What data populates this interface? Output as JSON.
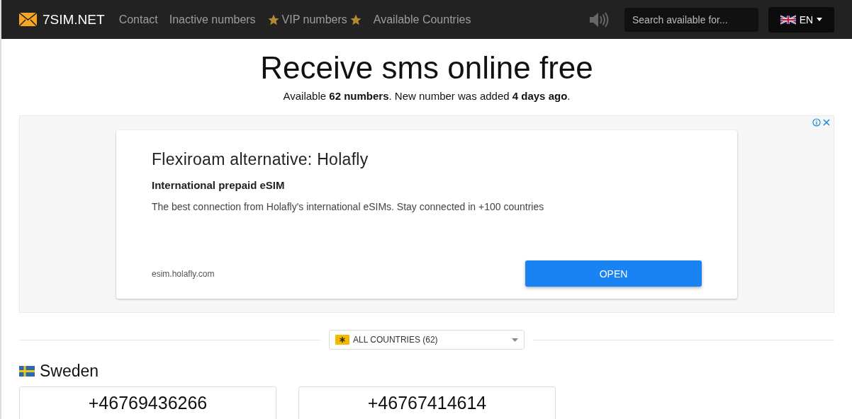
{
  "navbar": {
    "logo": "7SIM.NET",
    "links": [
      {
        "label": "Contact",
        "kind": "plain"
      },
      {
        "label": "Inactive numbers",
        "kind": "plain"
      },
      {
        "label": "VIP numbers",
        "kind": "starred"
      },
      {
        "label": "Available Countries",
        "kind": "plain"
      }
    ],
    "search": {
      "placeholder": "Search available for..."
    },
    "language": "EN"
  },
  "header": {
    "title": "Receive sms online free",
    "subtitle": "Available **62 numbers**. New number was added **4 days ago**."
  },
  "ad": {
    "headline": "Flexiroam alternative: Holafly",
    "subheadline": "International prepaid eSIM",
    "body": "The best connection from Holafly's international eSIMs. Stay connected in +100 countries",
    "domain": "esim.holafly.com",
    "button": "OPEN"
  },
  "filter": {
    "value": "ALL COUNTRIES (62)"
  },
  "country": {
    "name": "Sweden",
    "numbers": [
      "+46769436266",
      "+46767414614"
    ]
  }
}
